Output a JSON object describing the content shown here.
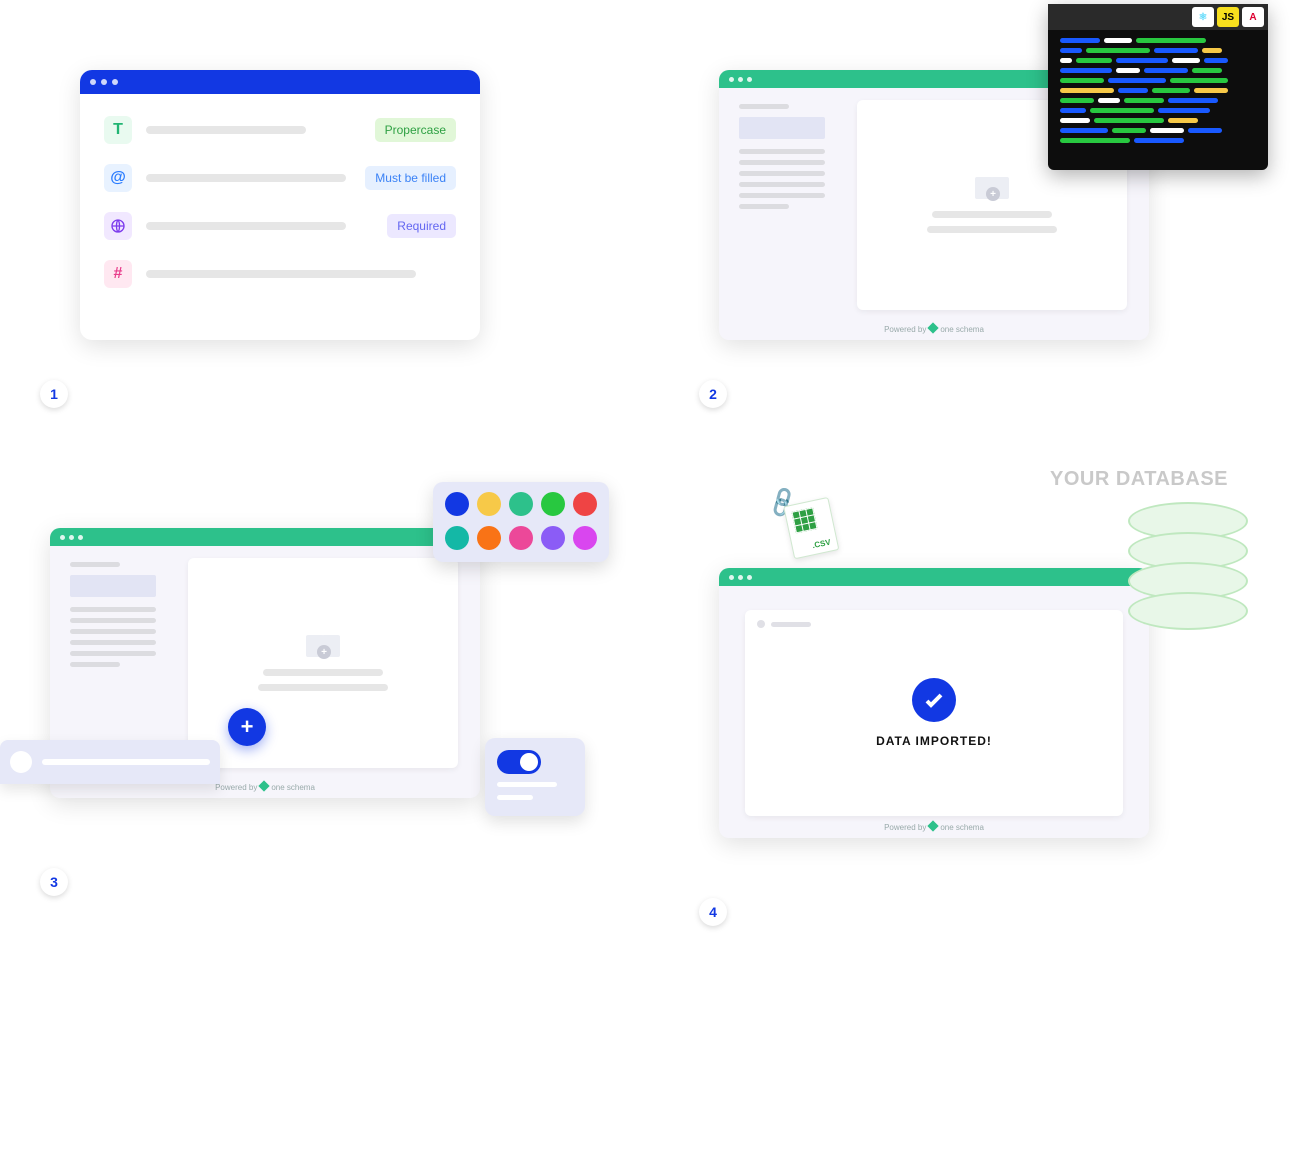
{
  "steps": {
    "s1": {
      "num": "1",
      "rows": [
        {
          "icon": "T",
          "pill": "Propercase"
        },
        {
          "icon": "@",
          "pill": "Must be filled"
        },
        {
          "icon": "web",
          "pill": "Required"
        },
        {
          "icon": "#",
          "pill": ""
        }
      ]
    },
    "s2": {
      "num": "2",
      "code_tabs": {
        "react": "⚛",
        "js": "JS",
        "ang": "A"
      },
      "powered": "Powered by",
      "brand": "one schema"
    },
    "s3": {
      "num": "3",
      "palette": [
        "#1238e3",
        "#f7c948",
        "#2dc18b",
        "#28c840",
        "#ef4444",
        "#14b8a6",
        "#f97316",
        "#ec4899",
        "#8b5cf6",
        "#d946ef"
      ],
      "powered": "Powered by",
      "brand": "one schema"
    },
    "s4": {
      "num": "4",
      "db_label": "YOUR DATABASE",
      "imported": "DATA IMPORTED!",
      "csv_label": ".CSV",
      "powered": "Powered by",
      "brand": "one schema"
    }
  }
}
